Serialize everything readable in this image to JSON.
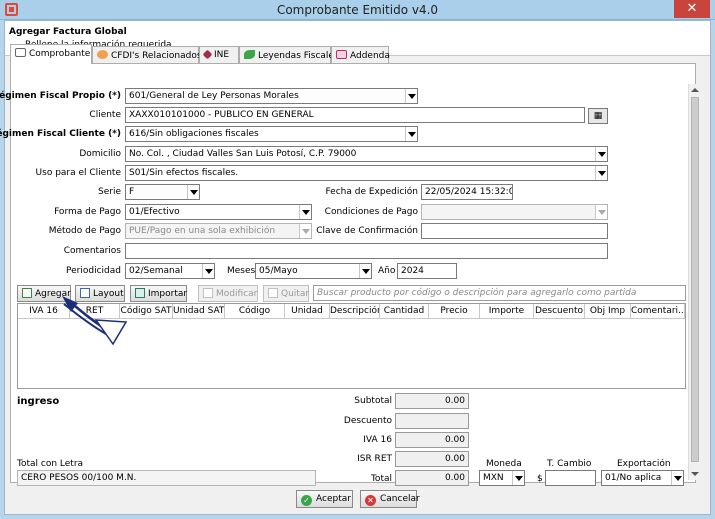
{
  "window": {
    "title": "Comprobante Emitido v4.0",
    "close_glyph": "✕"
  },
  "header": {
    "title": "Agregar Factura Global",
    "subtitle": "Rellene la información requerida"
  },
  "tabs": [
    {
      "label": "Comprobante",
      "icon": "document-icon"
    },
    {
      "label": "CFDI's Relacionados",
      "icon": "link-icon"
    },
    {
      "label": "INE",
      "icon": "ine-icon"
    },
    {
      "label": "Leyendas Fiscales",
      "icon": "leaf-icon"
    },
    {
      "label": "Addenda",
      "icon": "addenda-icon"
    }
  ],
  "form": {
    "regimen_propio": {
      "label": "Régimen Fiscal Propio (*)",
      "value": "601/General de Ley Personas Morales"
    },
    "cliente": {
      "label": "Cliente",
      "value": "XAXX010101000 - PUBLICO EN GENERAL"
    },
    "regimen_cliente": {
      "label": "Régimen Fiscal Cliente (*)",
      "value": "616/Sin obligaciones fiscales"
    },
    "domicilio": {
      "label": "Domicilio",
      "value": "No.  Col. , Ciudad Valles San Luis Potosí, C.P. 79000"
    },
    "uso": {
      "label": "Uso para el Cliente",
      "value": "S01/Sin efectos fiscales."
    },
    "serie": {
      "label": "Serie",
      "value": "F"
    },
    "fecha": {
      "label": "Fecha de Expedición",
      "value": "22/05/2024 15:32:00"
    },
    "forma_pago": {
      "label": "Forma de Pago",
      "value": "01/Efectivo"
    },
    "condiciones": {
      "label": "Condiciones de Pago",
      "value": ""
    },
    "metodo_pago": {
      "label": "Método de Pago",
      "value": "PUE/Pago en una sola exhibición"
    },
    "clave_conf": {
      "label": "Clave de Confirmación",
      "value": ""
    },
    "comentarios": {
      "label": "Comentarios",
      "value": ""
    },
    "periodicidad": {
      "label": "Periodicidad",
      "value": "02/Semanal"
    },
    "meses": {
      "label": "Meses",
      "value": "05/Mayo"
    },
    "anio": {
      "label": "Año",
      "value": "2024"
    }
  },
  "toolbar": {
    "agregar": "Agregar",
    "layout": "Layout",
    "importar": "Importar",
    "modificar": "Modificar",
    "quitar": "Quitar",
    "search_placeholder": "Buscar producto por código o descripción para agregarlo como partida"
  },
  "grid": {
    "columns": [
      "IVA 16",
      "RET",
      "Código SAT",
      "Unidad SAT",
      "Código",
      "Unidad",
      "Descripción",
      "Cantidad",
      "Precio",
      "Importe",
      "Descuento",
      "Obj Imp",
      "Comentari..."
    ]
  },
  "totals": {
    "tipo": "ingreso",
    "subtotal_label": "Subtotal",
    "subtotal": "0.00",
    "descuento_label": "Descuento",
    "descuento": "",
    "iva_label": "IVA 16",
    "iva": "0.00",
    "isr_label": "ISR RET",
    "isr": "0.00",
    "total_label": "Total",
    "total": "0.00"
  },
  "total_letra": {
    "label": "Total con Letra",
    "value": "CERO PESOS 00/100 M.N."
  },
  "moneda": {
    "label": "Moneda",
    "value": "MXN"
  },
  "tipo_cambio": {
    "label": "T. Cambio",
    "prefix": "$",
    "value": ""
  },
  "exportacion": {
    "label": "Exportación",
    "value": "01/No aplica"
  },
  "footer": {
    "aceptar": "Aceptar",
    "cancelar": "Cancelar"
  },
  "colors": {
    "titlebar": "#a9cfea",
    "close": "#c7453d",
    "arrow": "#1c2e78",
    "accent": "#1f6fd6"
  }
}
